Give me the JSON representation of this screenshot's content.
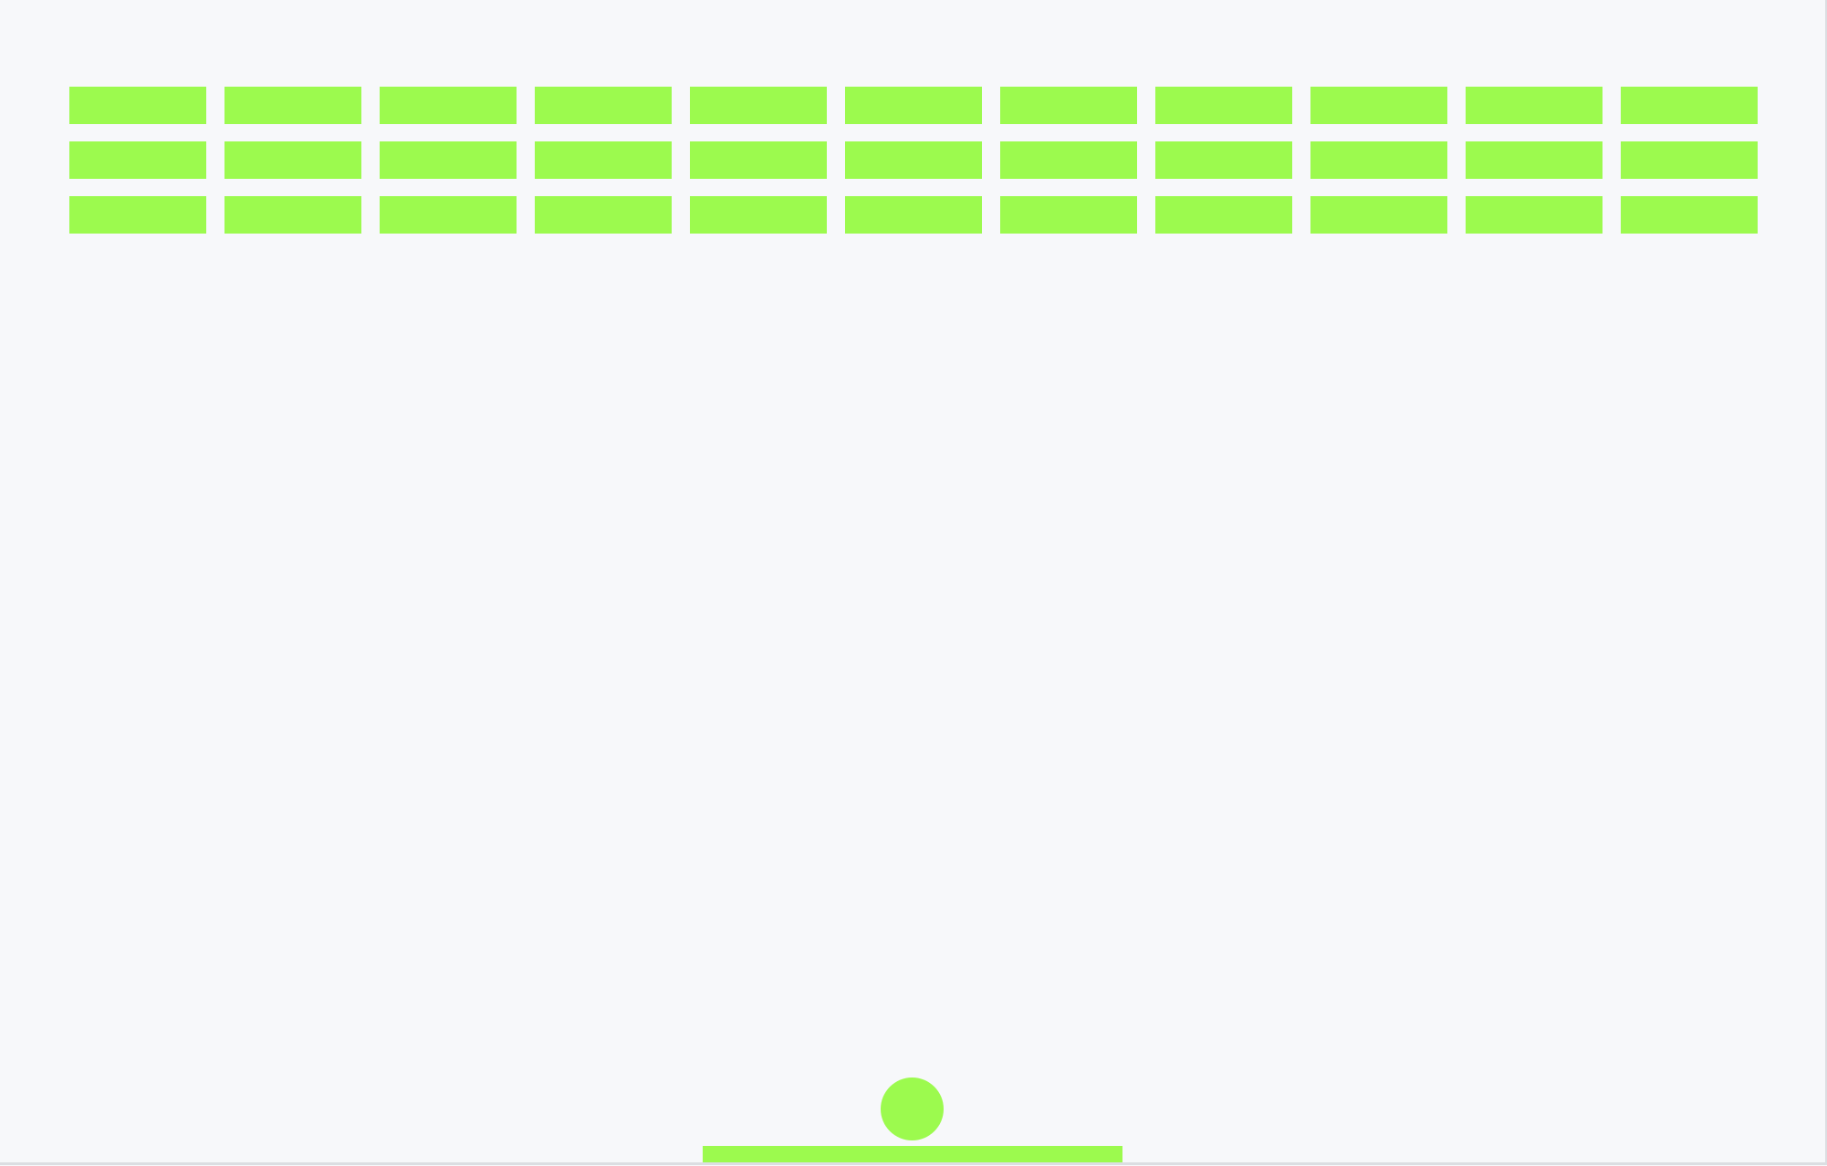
{
  "game": {
    "type": "breakout",
    "brick_rows": 3,
    "brick_columns": 11,
    "bricks_remaining": 33
  },
  "colors": {
    "background": "#f7f8fa",
    "brick": "#9cfa4e",
    "ball": "#9cfa4e",
    "paddle": "#9cfa4e",
    "border": "#dcdee2"
  }
}
